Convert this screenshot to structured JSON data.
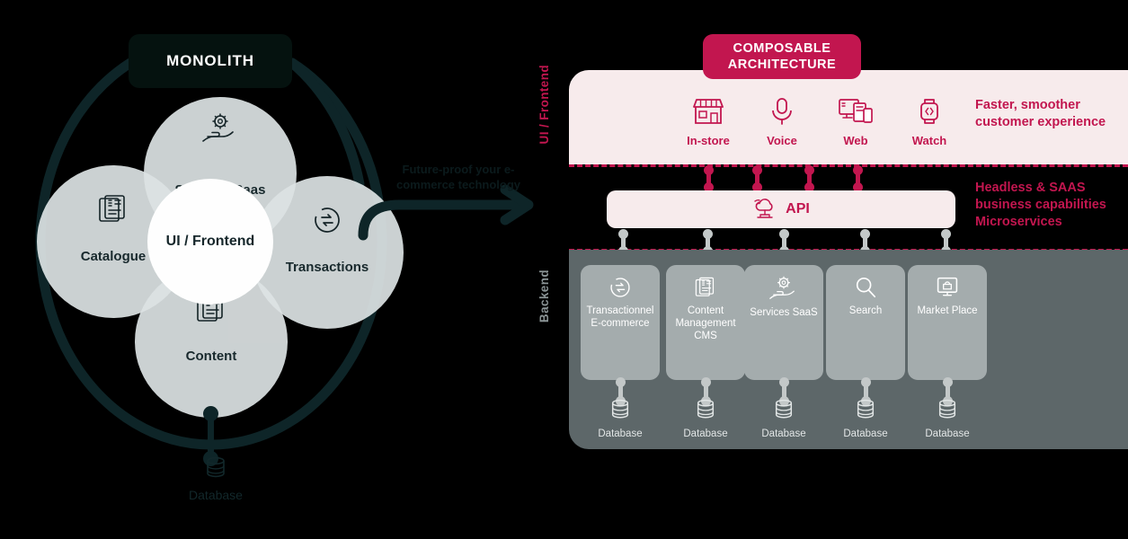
{
  "monolith": {
    "title": "MONOLITH",
    "center": {
      "label": "UI / Frontend"
    },
    "circles": [
      {
        "label": "Services Saas",
        "icon": "gear-in-hand-icon"
      },
      {
        "label": "Catalogue",
        "icon": "catalogue-document-icon"
      },
      {
        "label": "Transactions",
        "icon": "transactions-refresh-icon"
      },
      {
        "label": "Content",
        "icon": "content-document-icon"
      }
    ],
    "database": {
      "label": "Database",
      "icon": "database-icon"
    }
  },
  "transition": {
    "caption": "Future-proof your e-commerce technology",
    "icon": "right-arrow-icon"
  },
  "composable": {
    "badge": "COMPOSABLE ARCHITECTURE",
    "badge_line1": "COMPOSABLE",
    "badge_line2": "ARCHITECTURE",
    "layers": {
      "frontend_label": "UI / Frontend",
      "backend_label": "Backend"
    },
    "channels": [
      {
        "label": "In-store",
        "icon": "storefront-icon"
      },
      {
        "label": "Voice",
        "icon": "microphone-icon"
      },
      {
        "label": "Web",
        "icon": "devices-icon"
      },
      {
        "label": "Watch",
        "icon": "smartwatch-code-icon"
      }
    ],
    "api": {
      "label": "API",
      "icon": "cloud-network-icon"
    },
    "notes": {
      "frontend": "Faster, smoother customer experience",
      "backend_line1": "Headless & SAAS",
      "backend_line2": "business capabilities",
      "backend_line3": "Microservices"
    },
    "services": [
      {
        "label": "Transactionnel E-commerce",
        "icon": "transactions-refresh-icon",
        "db": "Database"
      },
      {
        "label": "Content Management CMS",
        "icon": "content-document-icon",
        "db": "Database"
      },
      {
        "label": "Services SaaS",
        "icon": "gear-in-hand-icon",
        "db": "Database"
      },
      {
        "label": "Search",
        "icon": "magnifier-icon",
        "db": "Database"
      },
      {
        "label": "Market Place",
        "icon": "marketplace-monitor-icon",
        "db": "Database"
      }
    ]
  },
  "colors": {
    "accent_pink": "#c2164f",
    "panel_pink": "#f7ebec",
    "backend_grey": "#5d6769",
    "card_grey": "#a4acad",
    "monolith_dark": "#0e2528",
    "circle_grey": "#dde3e4"
  }
}
